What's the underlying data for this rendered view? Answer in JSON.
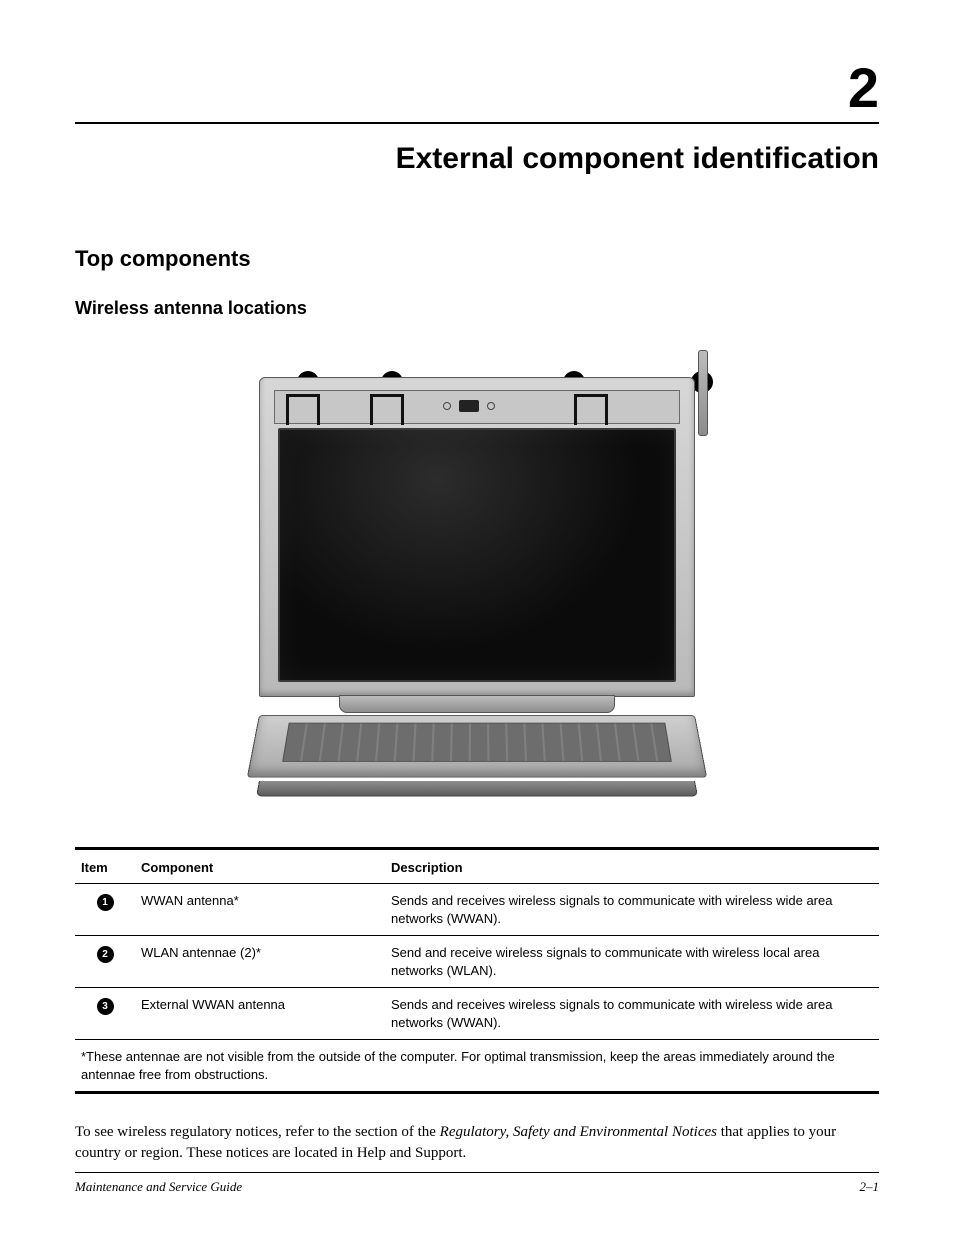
{
  "chapter": {
    "number": "2",
    "title": "External component identification"
  },
  "sections": {
    "h1": "Top components",
    "h2": "Wireless antenna locations"
  },
  "callouts": {
    "c1": "1",
    "c2": "2",
    "c3": "3"
  },
  "table": {
    "headers": {
      "item": "Item",
      "component": "Component",
      "description": "Description"
    },
    "rows": [
      {
        "item": "1",
        "component": "WWAN antenna*",
        "description": "Sends and receives wireless signals to communicate with wireless wide area networks (WWAN)."
      },
      {
        "item": "2",
        "component": "WLAN antennae (2)*",
        "description": "Send and receive wireless signals to communicate with wireless local area networks (WLAN)."
      },
      {
        "item": "3",
        "component": "External WWAN antenna",
        "description": "Sends and receives wireless signals to communicate with wireless wide area networks (WWAN)."
      }
    ],
    "footnote": "*These antennae are not visible from the outside of the computer. For optimal transmission, keep the areas immediately around the antennae free from obstructions."
  },
  "body": {
    "pre": "To see wireless regulatory notices, refer to the section of the ",
    "ital": "Regulatory, Safety and Environmental Notices",
    "post": " that applies to your country or region. These notices are located in Help and Support."
  },
  "footer": {
    "left": "Maintenance and Service Guide",
    "right": "2–1"
  }
}
